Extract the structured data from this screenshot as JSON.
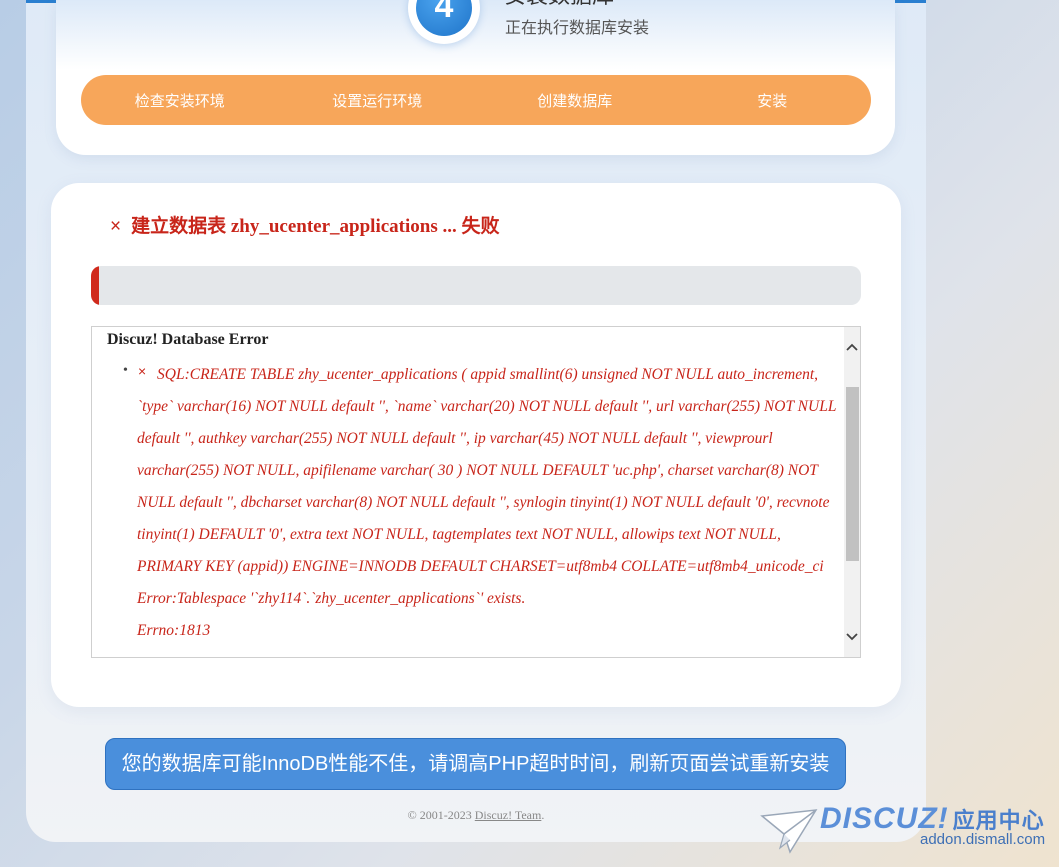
{
  "header": {
    "step_number": "4",
    "step_title": "安装数据库",
    "step_desc": "正在执行数据库安装",
    "steps": [
      "检查安装环境",
      "设置运行环境",
      "创建数据库",
      "安装"
    ]
  },
  "error": {
    "heading_icon": "×",
    "heading": "建立数据表 zhy_ucenter_applications ... 失败"
  },
  "progress": {
    "percent": 1
  },
  "log": {
    "title": "Discuz! Database Error",
    "bullet": "•",
    "icon": "×",
    "sql": "SQL:CREATE TABLE zhy_ucenter_applications ( appid smallint(6) unsigned NOT NULL auto_increment, `type` varchar(16) NOT NULL default '', `name` varchar(20) NOT NULL default '', url varchar(255) NOT NULL default '', authkey varchar(255) NOT NULL default '', ip varchar(45) NOT NULL default '', viewprourl varchar(255) NOT NULL, apifilename varchar( 30 ) NOT NULL DEFAULT 'uc.php', charset varchar(8) NOT NULL default '', dbcharset varchar(8) NOT NULL default '', synlogin tinyint(1) NOT NULL default '0', recvnote tinyint(1) DEFAULT '0', extra text NOT NULL, tagtemplates text NOT NULL, allowips text NOT NULL, PRIMARY KEY (appid)) ENGINE=INNODB DEFAULT CHARSET=utf8mb4 COLLATE=utf8mb4_unicode_ci",
    "error_line": "Error:Tablespace '`zhy114`.`zhy_ucenter_applications`' exists.",
    "errno_line": "Errno:1813"
  },
  "notice": "您的数据库可能InnoDB性能不佳，请调高PHP超时时间，刷新页面尝试重新安装",
  "footer": {
    "copyright": "© 2001-2023 ",
    "link": "Discuz! Team",
    "suffix": "."
  },
  "logo": {
    "text": "DISCUZ!",
    "cn": "应用中心",
    "url": "addon.dismall.com"
  },
  "colors": {
    "accent_blue": "#2a7fd0",
    "steps_orange": "#f7a65a",
    "error_red": "#c8251a",
    "notice_blue": "#4a8fdc"
  }
}
